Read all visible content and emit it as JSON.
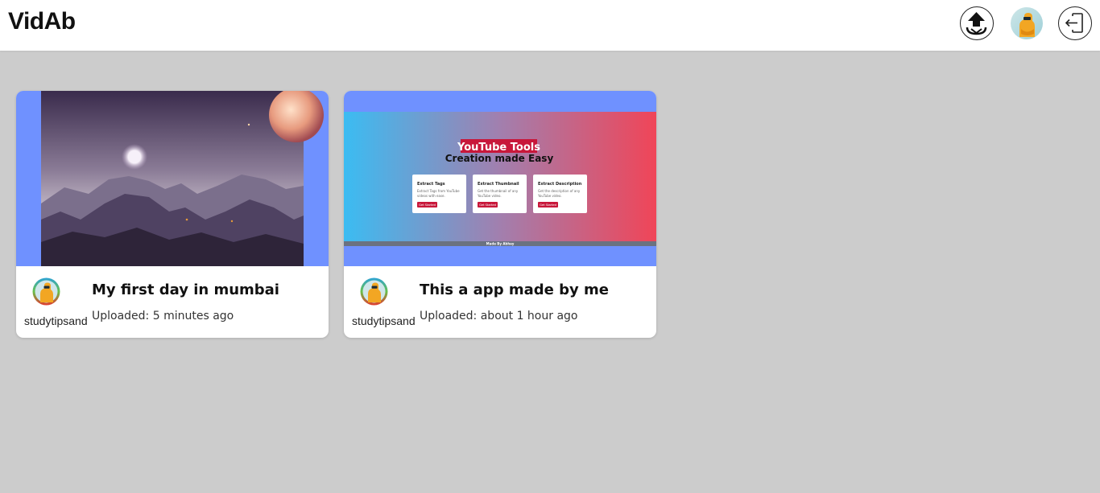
{
  "app": {
    "brand": "VidAb"
  },
  "header": {
    "actions": [
      {
        "name": "upload",
        "icon": "upload-icon"
      },
      {
        "name": "profile",
        "icon": "avatar"
      },
      {
        "name": "logout",
        "icon": "logout-icon"
      }
    ]
  },
  "videos": [
    {
      "title": "My first day in mumbai",
      "channel": "studytipsand",
      "uploaded": "Uploaded: 5 minutes ago",
      "thumbnail": "alien-landscape-image"
    },
    {
      "title": "This a app made by me",
      "channel": "studytipsand",
      "uploaded": "Uploaded: about 1 hour ago",
      "thumbnail": "youtube-tools-screenshot",
      "thumb_text": {
        "heading": "YouTube Tools",
        "subheading": "Creation made Easy",
        "cards": [
          {
            "title": "Extract Tags",
            "desc1": "Extract Tags from YouTube",
            "desc2": "videos with ease.",
            "button": "Get Started"
          },
          {
            "title": "Extract Thumbnail",
            "desc1": "Get the thumbnail of any",
            "desc2": "YouTube video.",
            "button": "Get Started"
          },
          {
            "title": "Extract Description",
            "desc1": "Get the description of any",
            "desc2": "YouTube video.",
            "button": "Get Started"
          }
        ],
        "footer": "Made By Abhay"
      }
    }
  ],
  "colors": {
    "page_bg": "#cccccc",
    "thumb_bg": "#6f91ff",
    "avatar_figure": "#f2a623"
  }
}
